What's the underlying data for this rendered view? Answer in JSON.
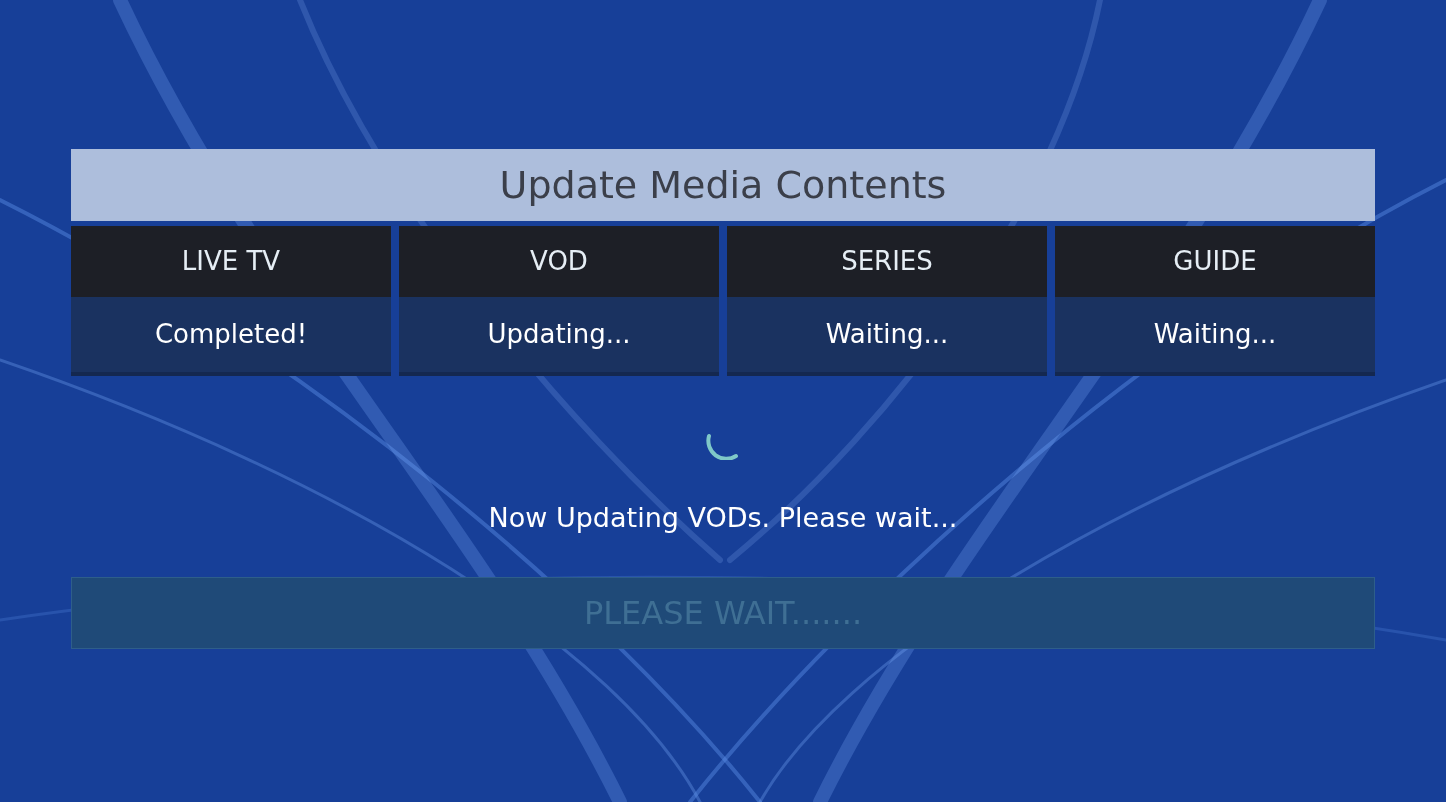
{
  "dialog": {
    "title": "Update Media Contents"
  },
  "sections": [
    {
      "label": "LIVE TV",
      "status": "Completed!"
    },
    {
      "label": "VOD",
      "status": "Updating..."
    },
    {
      "label": "SERIES",
      "status": "Waiting..."
    },
    {
      "label": "GUIDE",
      "status": "Waiting..."
    }
  ],
  "message": "Now Updating VODs. Please wait...",
  "button": {
    "label": "PLEASE WAIT.......",
    "disabled": true
  }
}
